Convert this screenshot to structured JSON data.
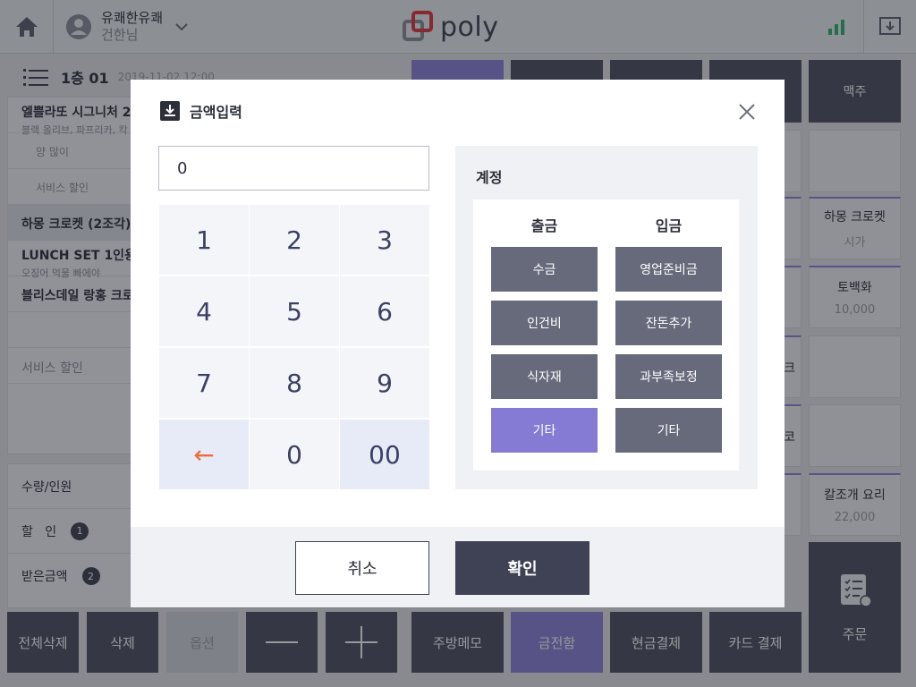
{
  "topbar": {
    "store_name": "유쾌한유쾌",
    "user_name": "건한님",
    "logo_text": "poly"
  },
  "order": {
    "table_no": "1층 01",
    "time": "2019-11-02 12:00",
    "items": [
      {
        "name": "엘쁠라또 시그니처 2",
        "sub": "블랙 올리브, 파프리카, 칵"
      },
      {
        "option": "양 많이"
      },
      {
        "option": "서비스 할인"
      },
      {
        "name": "하몽 크로켓 (2조각)"
      },
      {
        "name": "LUNCH SET 1인용",
        "sub": "오징어 먹물 빠에야"
      },
      {
        "name": "블리스데일 랑홍 크로"
      },
      {
        "service": "서비스 할인"
      }
    ]
  },
  "summary": {
    "quantity_label": "수량/인원",
    "discount_label": "할   인",
    "discount_badge": "1",
    "received_label": "받은금액",
    "received_badge": "2"
  },
  "bottom_buttons": {
    "delete_all": "전체삭제",
    "delete": "삭제",
    "option": "옵션",
    "kitchen_memo": "주방메모",
    "cash_drawer": "금전함",
    "cash_pay": "현금결제",
    "card_pay": "카드 결제",
    "order": "주문"
  },
  "menu": {
    "beer": "맥주",
    "item1_name": "하몽 크로켓",
    "item1_price": "시가",
    "item2_name": "토백화",
    "item2_price": "10,000",
    "item3_name": "칼조개 요리",
    "item3_price": "22,000",
    "partial1": "크",
    "partial2": "코"
  },
  "modal": {
    "title": "금액입력",
    "amount_value": "0",
    "keys": [
      "1",
      "2",
      "3",
      "4",
      "5",
      "6",
      "7",
      "8",
      "9",
      "←",
      "0",
      "00"
    ],
    "account_title": "계정",
    "withdraw_header": "출금",
    "deposit_header": "입금",
    "withdraw_items": [
      "수금",
      "인건비",
      "식자재",
      "기타"
    ],
    "deposit_items": [
      "영업준비금",
      "잔돈추가",
      "과부족보정",
      "기타"
    ],
    "cancel": "취소",
    "confirm": "확인"
  },
  "colors": {
    "accent_purple": "#867bd4",
    "dark_button": "#4d5160",
    "backspace_orange": "#f06a3b",
    "signal_green": "#2fb56a",
    "logo_red": "#e2353b"
  }
}
